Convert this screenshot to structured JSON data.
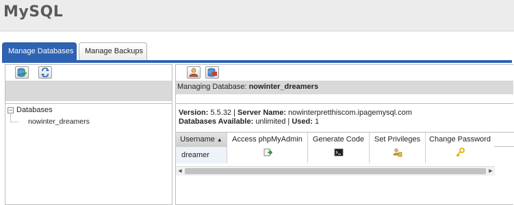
{
  "app": {
    "title": "MySQL"
  },
  "tabs": [
    {
      "label": "Manage Databases",
      "active": true
    },
    {
      "label": "Manage Backups",
      "active": false
    }
  ],
  "left_panel": {
    "toolbar": [
      {
        "icon": "add-database-icon"
      },
      {
        "icon": "refresh-icon"
      }
    ],
    "tree": {
      "root_label": "Databases",
      "toggle_symbol": "−",
      "items": [
        "nowinter_dreamers"
      ]
    }
  },
  "right_panel": {
    "toolbar": [
      {
        "icon": "add-user-icon"
      },
      {
        "icon": "database-user-icon"
      }
    ],
    "managing_label": "Managing Database:",
    "managing_db": "nowinter_dreamers",
    "info": {
      "version_label": "Version:",
      "version_value": "5.5.32",
      "sep": "|",
      "server_label": "Server Name:",
      "server_value": "nowinterpretthiscom.ipagemysql.com",
      "available_label": "Databases Available:",
      "available_value": "unlimited",
      "used_label": "Used:",
      "used_value": "1"
    },
    "table": {
      "columns": [
        "Username",
        "Access phpMyAdmin",
        "Generate Code",
        "Set Privileges",
        "Change Password"
      ],
      "sort_arrow": "▲",
      "rows": [
        {
          "username": "dreamer",
          "icons": [
            "phpmyadmin-icon",
            "terminal-icon",
            "privileges-icon",
            "key-icon"
          ]
        }
      ]
    },
    "scrollbar": {
      "left_arrow": "◀",
      "right_arrow": "▶"
    }
  },
  "colors": {
    "accent": "#2e62b2",
    "header_bg": "#ececec",
    "strip_bg": "#d9d9d9",
    "title_text": "#5a5a5a",
    "key_icon": "#e2b100"
  }
}
